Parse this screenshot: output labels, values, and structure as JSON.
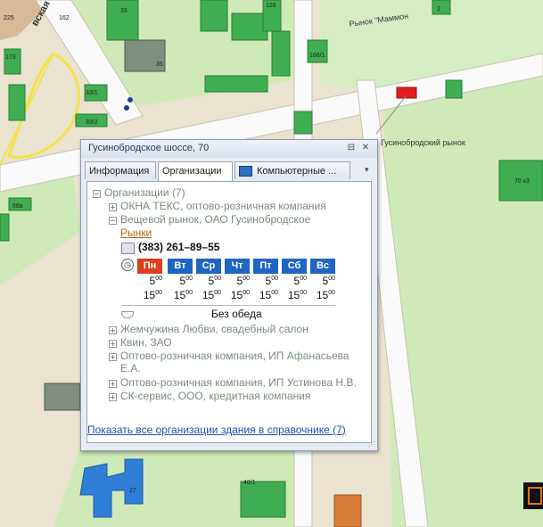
{
  "map": {
    "labels": {
      "street_vertical": "вская",
      "market_top": "Рынок \"Маммон",
      "market_right": "Гусинобродский рынок",
      "bldg_225": "225",
      "bldg_162": "162",
      "bldg_173": "173",
      "bldg_33": "33",
      "bldg_35": "35",
      "bldg_126": "126",
      "bldg_2": "2",
      "bldg_33_1": "33/1",
      "bldg_33_2": "33/2",
      "bldg_166_1": "166/1",
      "bldg_70k3": "70 к3",
      "bldg_68a": "68а",
      "bldg_27": "27",
      "bldg_40_1": "40/1"
    }
  },
  "popup": {
    "title": "Гусинобродское шоссе, 70",
    "tabs": [
      "Информация",
      "Организации",
      "Компьютерные ..."
    ],
    "tree": {
      "root_label": "Организации",
      "root_count": "(7)",
      "org1": "ОКНА ТЕКС, оптово-розничная компания",
      "org2": "Вещевой рынок, ОАО Гусинобродское",
      "org2_category": "Рынки",
      "phone": "(383) 261–89–55",
      "days": [
        "Пн",
        "Вт",
        "Ср",
        "Чт",
        "Пт",
        "Сб",
        "Вс"
      ],
      "open_h": "5",
      "close_h": "15",
      "minutes": "00",
      "no_break": "Без обеда",
      "org3": "Жемчужина Любви, свадебный салон",
      "org4": "Квин, ЗАО",
      "org5_l1": "Оптово-розничная компания, ИП Афанасьева",
      "org5_l2": "Е.А.",
      "org6": "Оптово-розничная компания, ИП Устинова Н.В.",
      "org7": "СК-сервис, ООО, кредитная компания"
    },
    "link_text": "Показать все организации здания в справочнике",
    "link_count": "(7)"
  },
  "colors": {
    "today": "#d9411e",
    "day": "#1f66c4",
    "accent": "#1a4fb0"
  }
}
